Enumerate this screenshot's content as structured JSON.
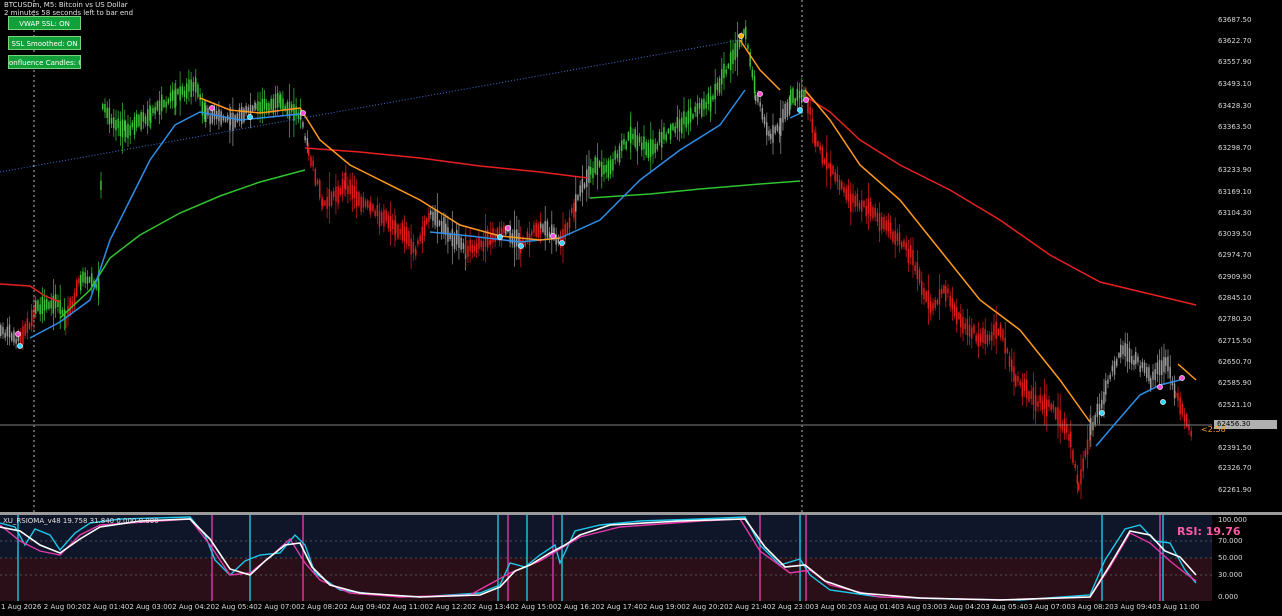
{
  "symbol_line1": "BTCUSDm, M5:  Bitcoin vs US Dollar",
  "symbol_line2": "2 minutes 58 seconds left to bar end",
  "buttons": [
    {
      "label": "VWAP SSL: ON"
    },
    {
      "label": "SSL Smoothed: ON"
    },
    {
      "label": "onfluence Candles: O"
    }
  ],
  "price_axis": [
    "63687.50",
    "63622.70",
    "63557.90",
    "63493.10",
    "63428.30",
    "63363.50",
    "63298.70",
    "63233.90",
    "63169.10",
    "63104.30",
    "63039.50",
    "62974.70",
    "62909.90",
    "62845.10",
    "62780.30",
    "62715.50",
    "62650.70",
    "62585.90",
    "62521.10",
    "62391.50",
    "62326.70",
    "62261.90"
  ],
  "current_price": "62456.30",
  "countdown": "<2:58",
  "indicator": {
    "title": "XU_RSIOMA_v48 19.758 31.840 0.000 0.000",
    "rsi_label": "RSI: 19.76",
    "levels": [
      "100.000",
      "70.000",
      "50.000",
      "30.000",
      "0.000"
    ]
  },
  "time_axis": [
    "1 Aug 2026",
    "2 Aug 00:20",
    "2 Aug 01:40",
    "2 Aug 03:00",
    "2 Aug 04:20",
    "2 Aug 05:40",
    "2 Aug 07:00",
    "2 Aug 08:20",
    "2 Aug 09:40",
    "2 Aug 11:00",
    "2 Aug 12:20",
    "2 Aug 13:40",
    "2 Aug 15:00",
    "2 Aug 16:20",
    "2 Aug 17:40",
    "2 Aug 19:00",
    "2 Aug 20:20",
    "2 Aug 21:40",
    "2 Aug 23:00",
    "3 Aug 00:20",
    "3 Aug 01:40",
    "3 Aug 03:00",
    "3 Aug 04:20",
    "3 Aug 05:40",
    "3 Aug 07:00",
    "3 Aug 08:20",
    "3 Aug 09:40",
    "3 Aug 11:00"
  ],
  "colors": {
    "bull": "#3cc43c",
    "bear": "#e21d1d",
    "neutral": "#9a9a9a",
    "ssl_blue": "#2e8ee8",
    "ssl_orange": "#ff9a1e",
    "vwap_green": "#2fc42f",
    "vwap_red": "#e82020",
    "rsi_white": "#ffffff",
    "rsi_cyan": "#1ec8e8",
    "rsi_pink": "#e23aa8"
  }
}
